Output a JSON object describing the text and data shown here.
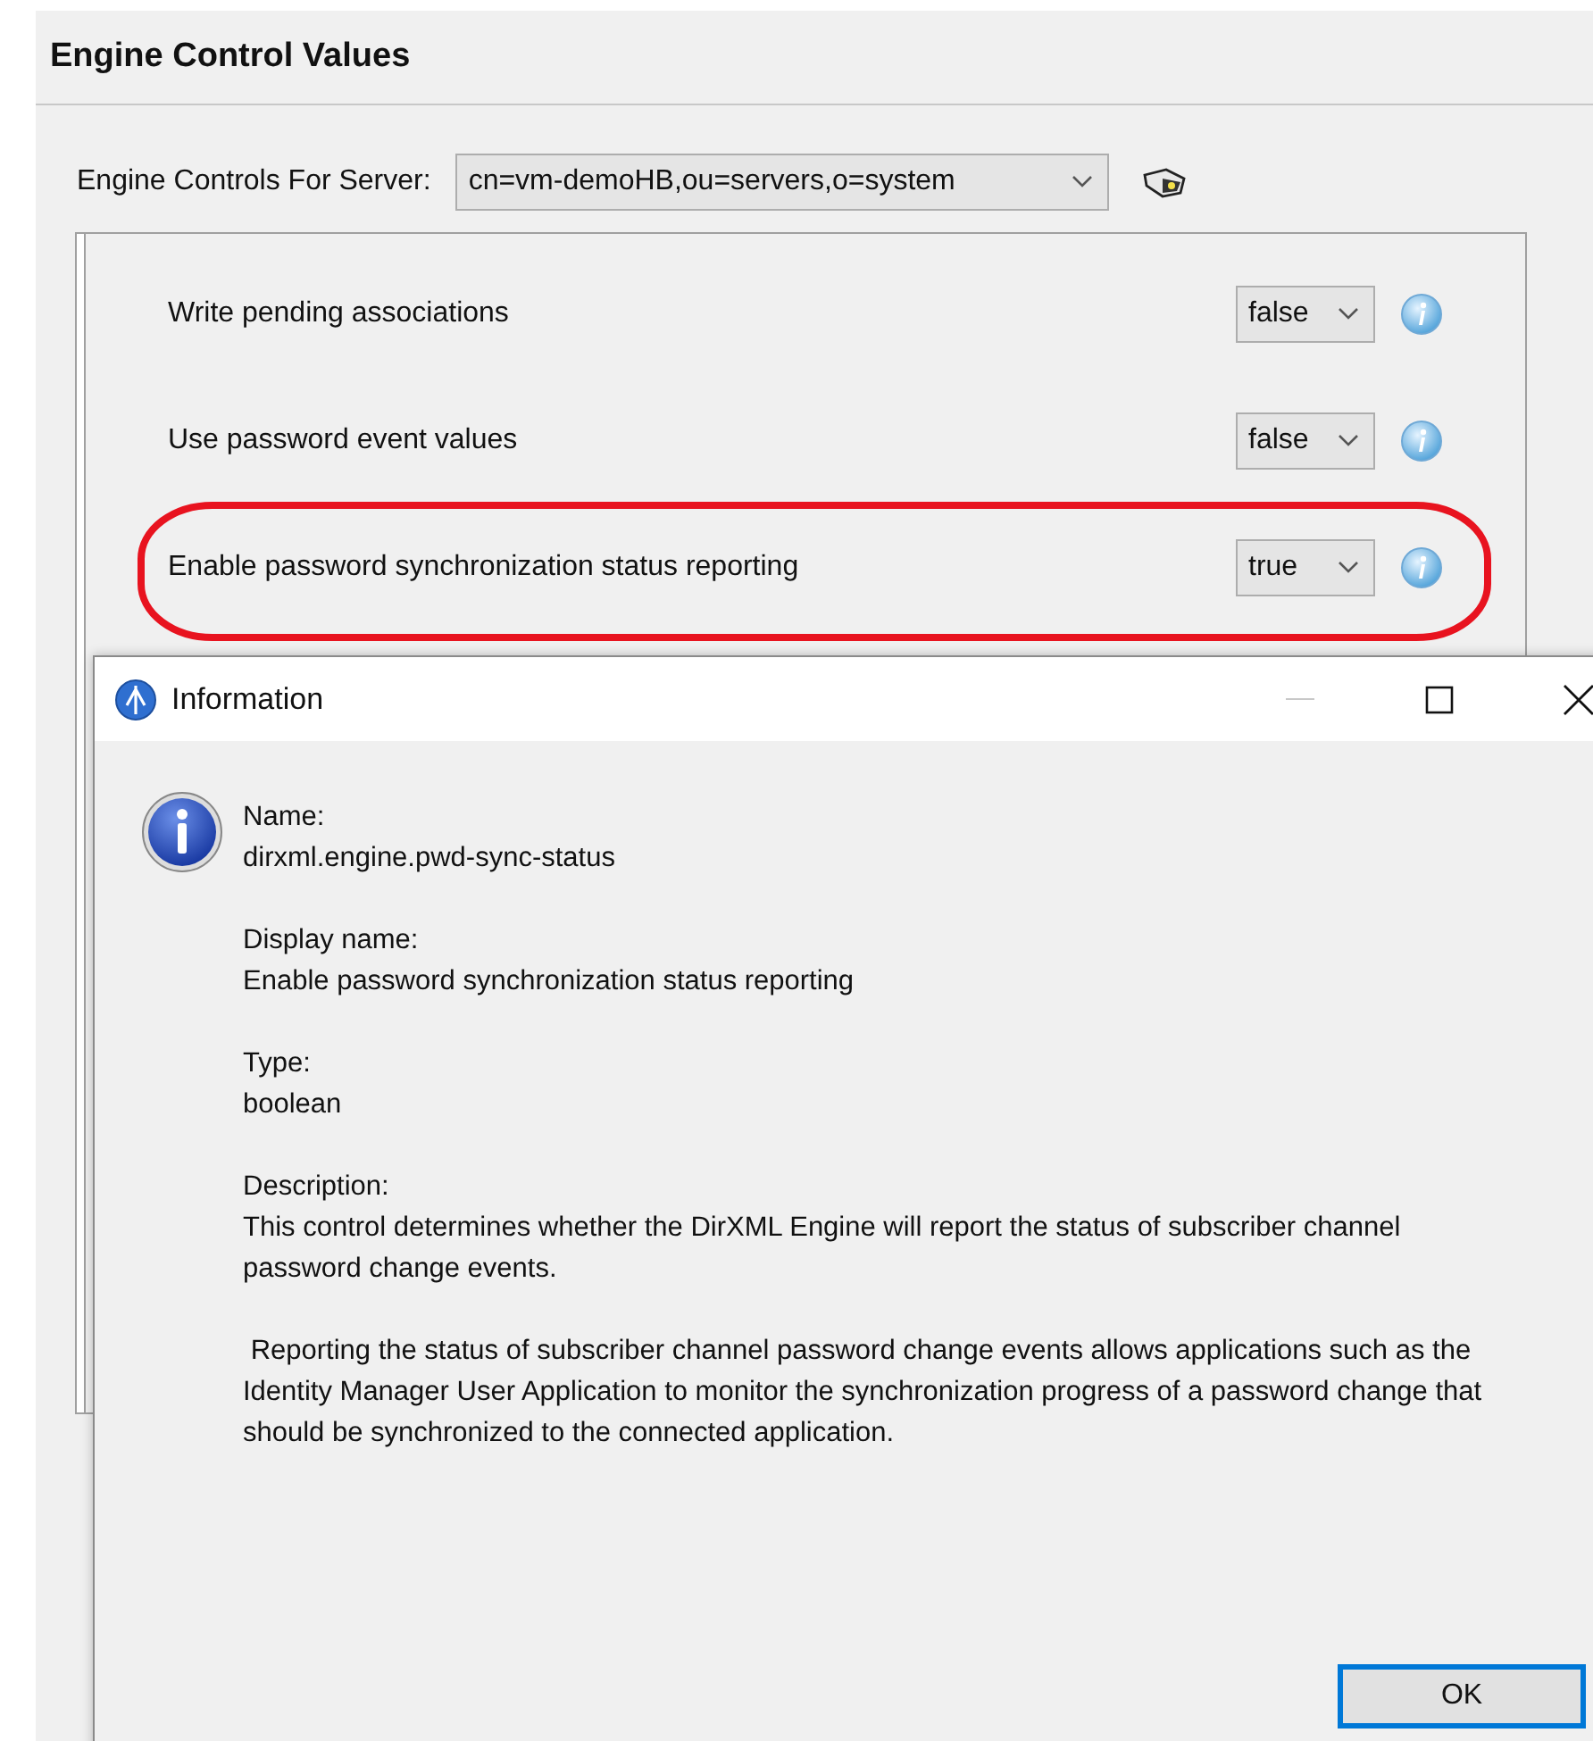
{
  "panel": {
    "title": "Engine Control Values"
  },
  "server": {
    "label": "Engine Controls For Server:",
    "value": "cn=vm-demoHB,ou=servers,o=system"
  },
  "controls": [
    {
      "label": "Write pending associations",
      "value": "false",
      "highlighted": false
    },
    {
      "label": "Use password event values",
      "value": "false",
      "highlighted": false
    },
    {
      "label": "Enable password synchronization status reporting",
      "value": "true",
      "highlighted": true
    }
  ],
  "dialog": {
    "title": "Information",
    "sections": [
      {
        "heading": "Name:",
        "paragraphs": [
          "dirxml.engine.pwd-sync-status"
        ]
      },
      {
        "heading": "Display name:",
        "paragraphs": [
          "Enable password synchronization status reporting"
        ]
      },
      {
        "heading": "Type:",
        "paragraphs": [
          "boolean"
        ]
      },
      {
        "heading": "Description:",
        "paragraphs": [
          "This control determines whether the DirXML Engine will report the status of subscriber channel password change events.",
          " Reporting the status of subscriber channel password change events allows applications such as the Identity Manager User Application to monitor the synchronization progress of a password change that should be synchronized to the connected application."
        ]
      }
    ],
    "button": "OK"
  }
}
